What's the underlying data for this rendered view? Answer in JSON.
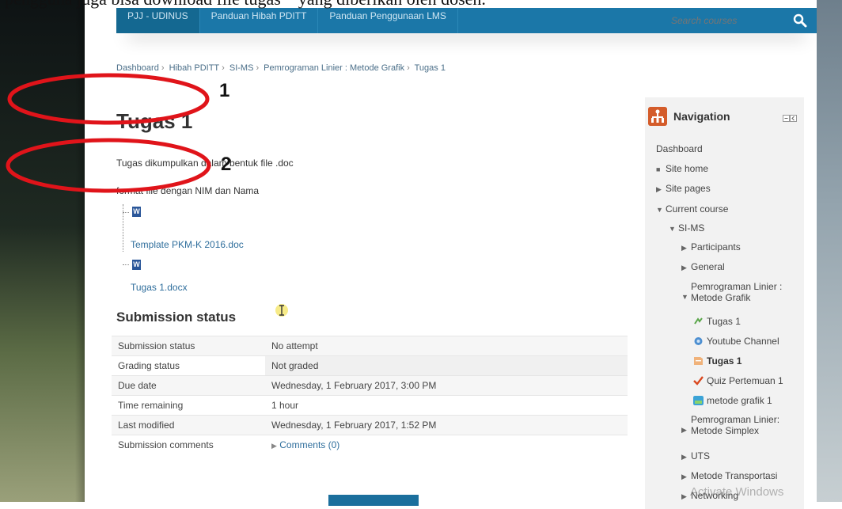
{
  "caption": "pengguna juga bisa download file tugas * yang diberikan oleh dosen.",
  "topnav": {
    "items": [
      "PJJ - UDINUS",
      "Panduan Hibah PDITT",
      "Panduan Penggunaan LMS"
    ],
    "search_placeholder": "Search courses"
  },
  "breadcrumb": [
    "Dashboard",
    "Hibah PDITT",
    "SI-MS",
    "Pemrograman Linier : Metode Grafik",
    "Tugas 1"
  ],
  "page_title": "Tugas 1",
  "intro": {
    "line1": "Tugas dikumpulkan dalam bentuk file .doc",
    "line2": "format file dengan NIM dan Nama"
  },
  "files": [
    "Template PKM-K 2016.doc",
    "Tugas 1.docx"
  ],
  "submission": {
    "title": "Submission status",
    "rows": [
      {
        "label": "Submission status",
        "value": "No attempt"
      },
      {
        "label": "Grading status",
        "value": "Not graded"
      },
      {
        "label": "Due date",
        "value": "Wednesday, 1 February 2017, 3:00 PM"
      },
      {
        "label": "Time remaining",
        "value": "1 hour"
      },
      {
        "label": "Last modified",
        "value": "Wednesday, 1 February 2017, 1:52 PM"
      },
      {
        "label": "Submission comments",
        "value": "Comments (0)"
      }
    ]
  },
  "navigation": {
    "title": "Navigation",
    "items": [
      {
        "label": "Dashboard"
      },
      {
        "label": "Site home"
      },
      {
        "label": "Site pages"
      },
      {
        "label": "Current course"
      },
      {
        "label": "SI-MS"
      },
      {
        "label": "Participants"
      },
      {
        "label": "General"
      },
      {
        "label": "Pemrograman Linier :",
        "label2": "Metode Grafik"
      },
      {
        "label": "Tugas 1",
        "icon": "forum-icon"
      },
      {
        "label": "Youtube Channel",
        "icon": "url-icon"
      },
      {
        "label": "Tugas 1",
        "icon": "assignment-icon"
      },
      {
        "label": "Quiz Pertemuan 1",
        "icon": "quiz-icon"
      },
      {
        "label": "metode grafik 1",
        "icon": "page-icon"
      },
      {
        "label": "Pemrograman Linier:",
        "label2": "Metode Simplex"
      },
      {
        "label": "UTS"
      },
      {
        "label": "Metode Transportasi"
      },
      {
        "label": "Networking"
      }
    ]
  },
  "watermark": "Activate Windows",
  "annotations": [
    "1",
    "2"
  ],
  "colors": {
    "topbar": "#1b77a8",
    "annotation": "#e0141a",
    "link": "#2f6e9c",
    "nav_icon": "#d45c2a"
  }
}
